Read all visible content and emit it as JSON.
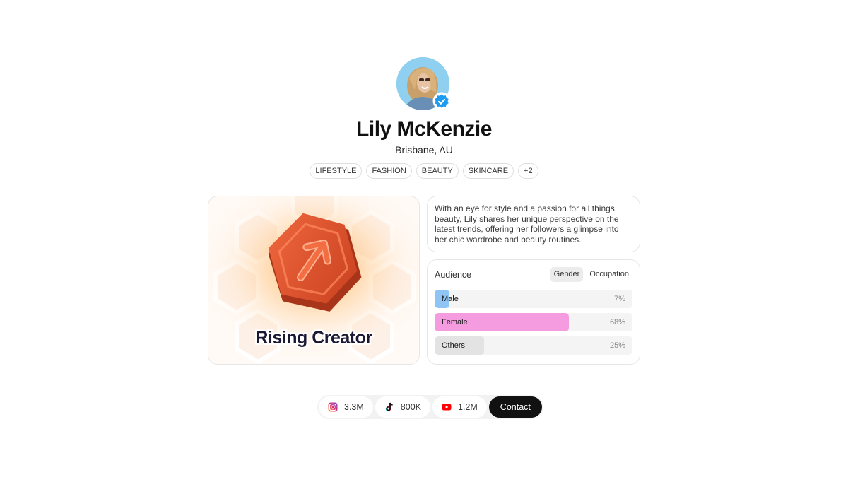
{
  "profile": {
    "name": "Lily McKenzie",
    "location": "Brisbane, AU",
    "verified": true
  },
  "tags": [
    "LIFESTYLE",
    "FASHION",
    "BEAUTY",
    "SKINCARE",
    "+2"
  ],
  "badge": {
    "title": "Rising Creator",
    "icon": "arrow-up-right-icon",
    "color": "#e2532c"
  },
  "bio": "With an eye for style and a passion for all things beauty, Lily shares her unique perspective on the latest trends, offering her followers a glimpse into her chic wardrobe and beauty routines.",
  "audience": {
    "title": "Audience",
    "tabs": [
      {
        "label": "Gender",
        "active": true
      },
      {
        "label": "Occupation",
        "active": false
      }
    ],
    "bars": [
      {
        "label": "Male",
        "value_label": "7%",
        "value": 7,
        "color": "#8ec5f5"
      },
      {
        "label": "Female",
        "value_label": "68%",
        "value": 68,
        "color": "#f59be0"
      },
      {
        "label": "Others",
        "value_label": "25%",
        "value": 25,
        "color": "#e3e3e3"
      }
    ]
  },
  "socials": [
    {
      "platform": "instagram-icon",
      "count": "3.3M"
    },
    {
      "platform": "tiktok-icon",
      "count": "800K"
    },
    {
      "platform": "youtube-icon",
      "count": "1.2M"
    }
  ],
  "contact_label": "Contact"
}
